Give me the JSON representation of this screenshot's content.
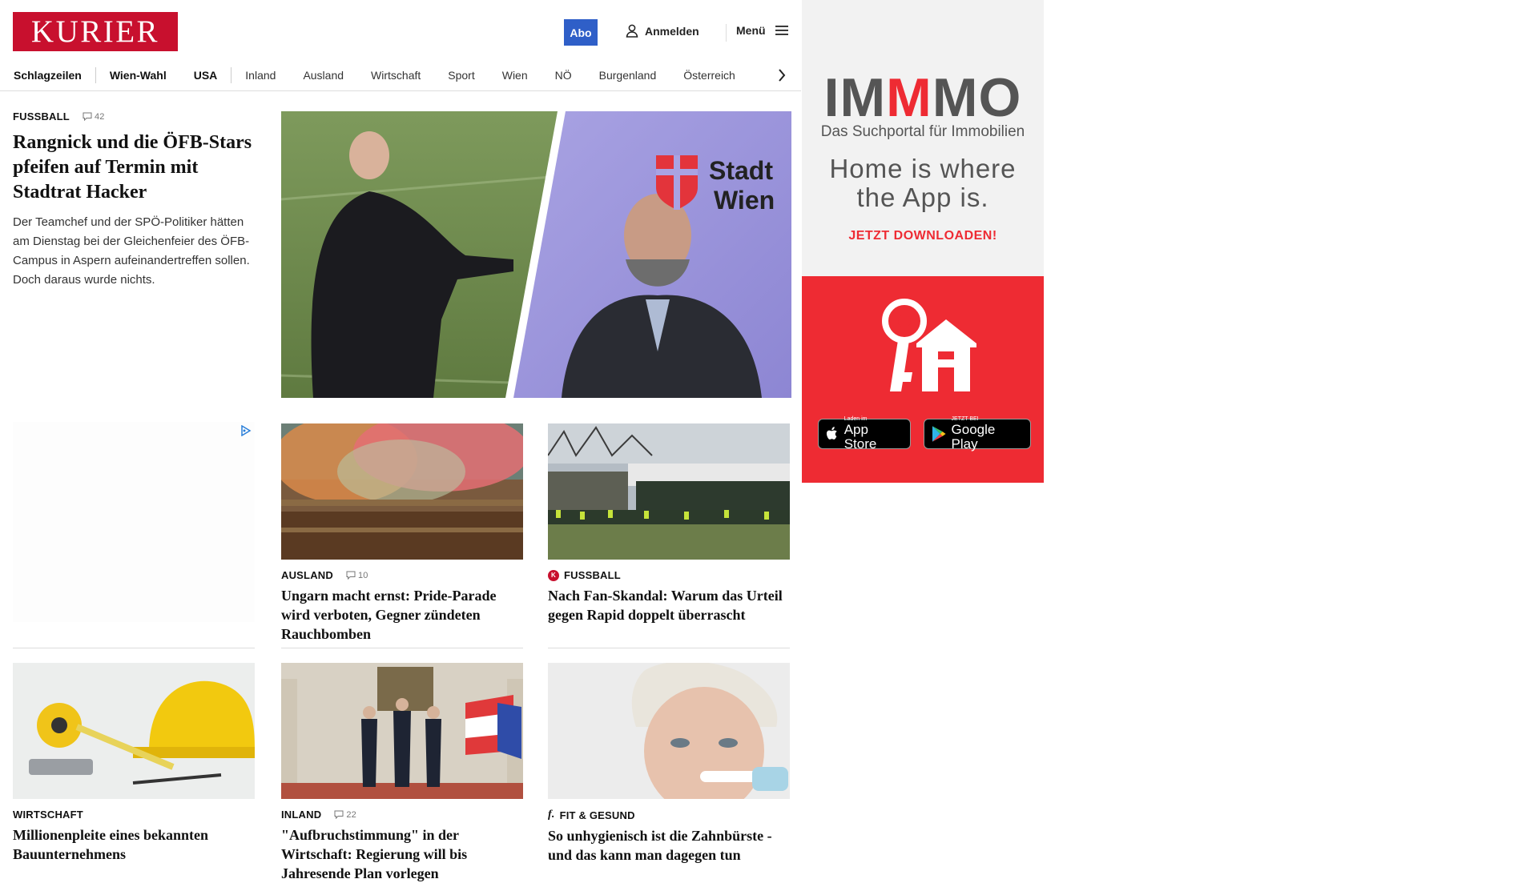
{
  "header": {
    "logo": "KURIER",
    "abo_label": "Abo",
    "login_label": "Anmelden",
    "menu_label": "Menü"
  },
  "nav": {
    "items": [
      "Schlagzeilen",
      "Wien-Wahl",
      "USA",
      "Inland",
      "Ausland",
      "Wirtschaft",
      "Sport",
      "Wien",
      "NÖ",
      "Burgenland",
      "Österreich"
    ]
  },
  "lead": {
    "kicker": "FUSSBALL",
    "comments": "42",
    "headline": "Rangnick und die ÖFB-Stars pfeifen auf Termin mit Stadtrat Hacker",
    "teaser": "Der Teamchef und der SPÖ-Politiker hätten am Dienstag bei der Gleichenfeier des ÖFB-Campus in Aspern aufeinandertreffen sollen. Doch daraus wurde nichts.",
    "image_text": "Stadt Wien"
  },
  "cards": [
    {
      "kicker": "AUSLAND",
      "comments": "10",
      "headline": "Ungarn macht ernst: Pride-Parade wird verboten, Gegner zündeten Rauchbomben"
    },
    {
      "kicker": "FUSSBALL",
      "headline": "Nach Fan-Skandal: Warum das Urteil gegen Rapid doppelt überrascht"
    },
    {
      "kicker": "WIRTSCHAFT",
      "headline": "Millionenpleite eines bekannten Bauunternehmens"
    },
    {
      "kicker": "INLAND",
      "comments": "22",
      "headline": "\"Aufbruchstimmung\" in der Wirtschaft: Regierung will bis Jahresende Plan vorlegen"
    },
    {
      "kicker": "FIT & GESUND",
      "headline": "So unhygienisch ist die Zahnbürste - und das kann man dagegen tun"
    }
  ],
  "ad": {
    "brand_pre": "IM",
    "brand_mid": "M",
    "brand_post": "MO",
    "subline": "Das Suchportal für Immobilien",
    "slogan_1": "Home is where",
    "slogan_2": "the App is.",
    "cta": "JETZT DOWNLOADEN!",
    "appstore_small": "Laden im",
    "appstore_big": "App Store",
    "googleplay_small": "JETZT BEI",
    "googleplay_big": "Google Play"
  },
  "colors": {
    "brand_red": "#c8102e",
    "abo_blue": "#2f5fc8",
    "ad_red": "#ee2b33"
  }
}
